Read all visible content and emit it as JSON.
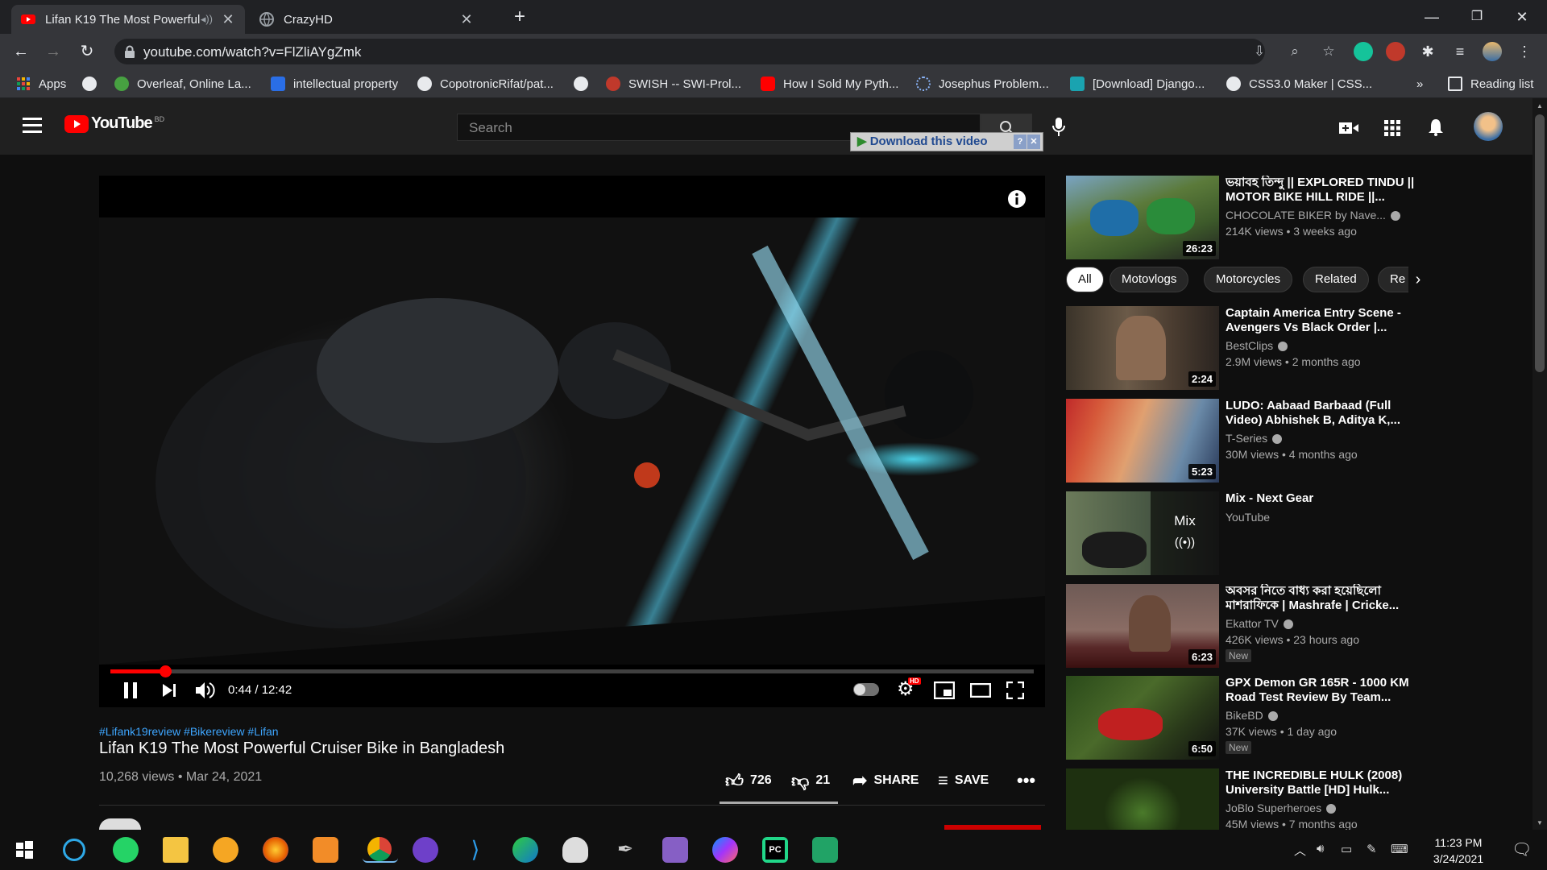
{
  "browser": {
    "tabs": [
      {
        "title": "Lifan K19 The Most Powerful",
        "active": true
      },
      {
        "title": "CrazyHD",
        "active": false
      }
    ],
    "url": "youtube.com/watch?v=FlZliAYgZmk",
    "bookmarks": [
      "Apps",
      "Overleaf, Online La...",
      "intellectual property",
      "CopotronicRifat/pat...",
      "SWISH -- SWI-Prol...",
      "How I Sold My Pyth...",
      "Josephus Problem...",
      "[Download] Django...",
      "CSS3.0 Maker | CSS...",
      "»",
      "Reading list"
    ]
  },
  "youtube": {
    "logo_text": "YouTube",
    "region": "BD",
    "search_placeholder": "Search",
    "download_bar": "Download this video"
  },
  "player": {
    "time": "0:44 / 12:42",
    "progress_fraction": 0.059,
    "buffered_fraction": 0.06,
    "hd_badge": "HD"
  },
  "video": {
    "hashtags": "#Lifank19review #Bikereview #Lifan",
    "title": "Lifan K19 The Most Powerful Cruiser Bike in Bangladesh",
    "meta": "10,268 views • Mar 24, 2021",
    "likes": "726",
    "dislikes": "21",
    "share": "SHARE",
    "save": "SAVE",
    "like_ratio": 0.97
  },
  "sidebar": {
    "top_video": {
      "title": "ভয়াবহ তিন্দু || EXPLORED TINDU || MOTOR BIKE HILL RIDE ||...",
      "channel": "CHOCOLATE BIKER by Nave...",
      "views": "214K views • 3 weeks ago",
      "duration": "26:23"
    },
    "chips": [
      "All",
      "Motovlogs",
      "Motorcycles",
      "Related",
      "Re"
    ],
    "videos": [
      {
        "title": "Captain America Entry Scene - Avengers Vs Black Order |...",
        "channel": "BestClips",
        "views": "2.9M views • 2 months ago",
        "duration": "2:24",
        "new": ""
      },
      {
        "title": "LUDO: Aabaad Barbaad (Full Video) Abhishek B, Aditya K,...",
        "channel": "T-Series",
        "views": "30M views • 4 months ago",
        "duration": "5:23",
        "new": ""
      },
      {
        "title": "Mix - Next Gear",
        "channel": "YouTube",
        "views": "",
        "duration": "",
        "new": "",
        "mix_label": "Mix"
      },
      {
        "title": "অবসর নিতে বাধ্য করা হয়েছিলো মাশরাফিকে | Mashrafe | Cricke...",
        "channel": "Ekattor TV",
        "views": "426K views • 23 hours ago",
        "duration": "6:23",
        "new": "New"
      },
      {
        "title": "GPX Demon GR 165R - 1000 KM Road Test Review By Team...",
        "channel": "BikeBD",
        "views": "37K views • 1 day ago",
        "duration": "6:50",
        "new": "New"
      },
      {
        "title": "THE INCREDIBLE HULK (2008) University Battle [HD] Hulk...",
        "channel": "JoBlo Superheroes",
        "views": "45M views • 7 months ago",
        "duration": "",
        "new": ""
      }
    ]
  },
  "taskbar": {
    "time": "11:23 PM",
    "date": "3/24/2021"
  },
  "colors": {
    "accent_red": "#ff0000",
    "link_blue": "#3ea6ff",
    "bg": "#0f0f0f"
  }
}
